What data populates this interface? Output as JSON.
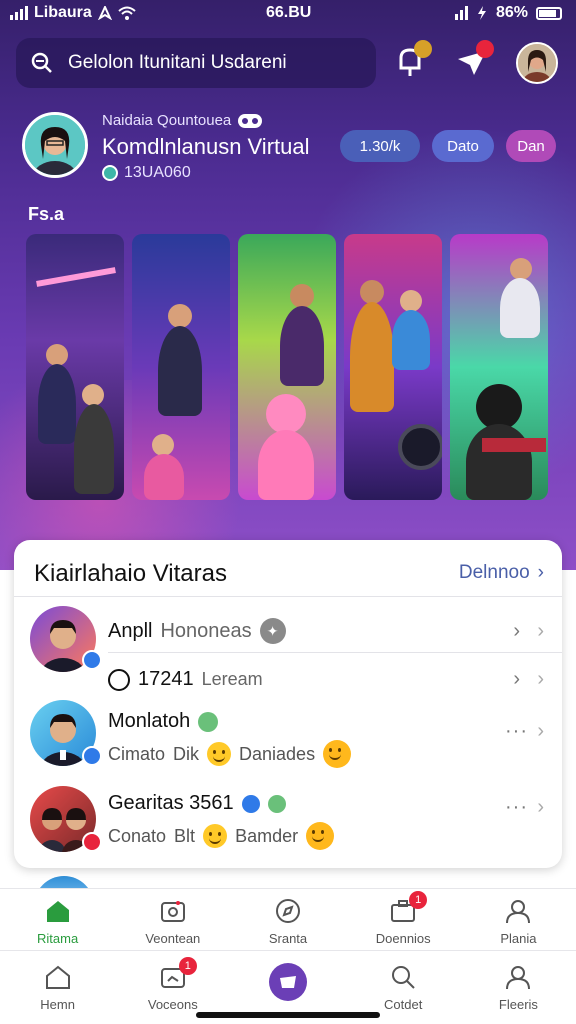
{
  "status_bar": {
    "carrier": "Libaura",
    "time": "66.BU",
    "battery": "86%"
  },
  "search": {
    "placeholder": "Gelolon Itunitani Usdareni"
  },
  "profile": {
    "small_text": "Naidaia Qountouea",
    "name": "Komdlnlanusn Virtual",
    "handle": "13UA060"
  },
  "pills": [
    {
      "label": "1.30/k",
      "color": "#4a5fb8"
    },
    {
      "label": "Dato",
      "color": "#5a6ad0"
    },
    {
      "label": "Dan",
      "color": "#b04ab8"
    }
  ],
  "section_tag": "Fs.a",
  "panel": {
    "title": "Kiairlahaio Vitaras",
    "link": "Delnnoo",
    "rows": [
      {
        "title": "Anpll",
        "title_extra": "Hononeas"
      },
      {
        "title": "17241",
        "title_extra": "Leream"
      },
      {
        "title": "Monlatoh",
        "sub_a": "Cimato",
        "sub_b": "Dik",
        "sub_c": "Daniades"
      },
      {
        "title": "Gearitas 3561",
        "sub_a": "Conato",
        "sub_b": "Blt",
        "sub_c": "Bamder"
      }
    ]
  },
  "tabbar_top": [
    {
      "label": "Ritama",
      "icon": "home-icon"
    },
    {
      "label": "Veontean",
      "icon": "camera-icon"
    },
    {
      "label": "Sranta",
      "icon": "compass-icon"
    },
    {
      "label": "Doennios",
      "icon": "briefcase-icon",
      "badge": "1"
    },
    {
      "label": "Plania",
      "icon": "user-icon"
    }
  ],
  "tabbar_bottom": [
    {
      "label": "Hemn",
      "icon": "home-icon"
    },
    {
      "label": "Voceons",
      "icon": "camera-icon",
      "badge": "1"
    },
    {
      "label": "",
      "icon": "create-icon"
    },
    {
      "label": "Cotdet",
      "icon": "search-icon"
    },
    {
      "label": "Fleeris",
      "icon": "user-icon"
    }
  ],
  "colors": {
    "accent_green": "#2a9c3e",
    "link_blue": "#4a5fa8",
    "hero_purple": "#4a2b8f"
  }
}
